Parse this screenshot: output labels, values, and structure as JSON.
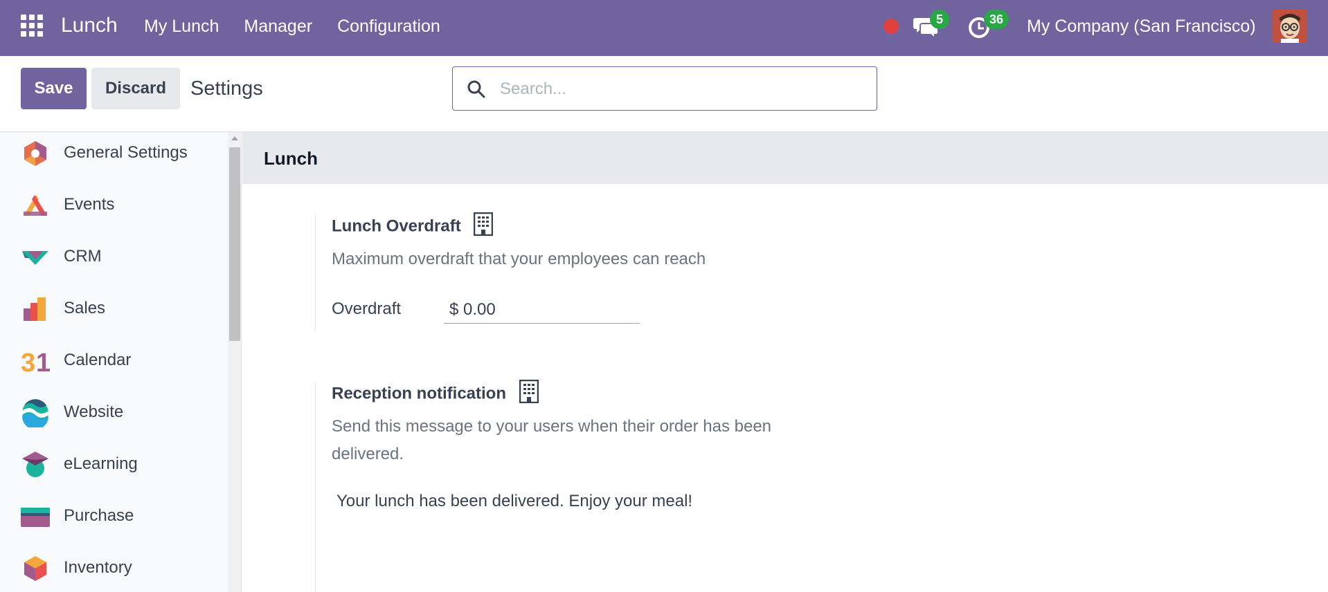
{
  "navbar": {
    "brand": "Lunch",
    "menu": [
      "My Lunch",
      "Manager",
      "Configuration"
    ],
    "messages_count": "5",
    "activities_count": "36",
    "company": "My Company (San Francisco)",
    "color": "#71639e"
  },
  "control_panel": {
    "save_label": "Save",
    "discard_label": "Discard",
    "title": "Settings",
    "search_placeholder": "Search..."
  },
  "sidebar": {
    "items": [
      {
        "label": "General Settings",
        "icon": "general-settings-icon"
      },
      {
        "label": "Events",
        "icon": "events-icon"
      },
      {
        "label": "CRM",
        "icon": "crm-icon"
      },
      {
        "label": "Sales",
        "icon": "sales-icon"
      },
      {
        "label": "Calendar",
        "icon": "calendar-icon"
      },
      {
        "label": "Website",
        "icon": "website-icon"
      },
      {
        "label": "eLearning",
        "icon": "elearning-icon"
      },
      {
        "label": "Purchase",
        "icon": "purchase-icon"
      },
      {
        "label": "Inventory",
        "icon": "inventory-icon"
      }
    ]
  },
  "main": {
    "section_title": "Lunch",
    "overdraft": {
      "title": "Lunch Overdraft",
      "description": "Maximum overdraft that your employees can reach",
      "field_label": "Overdraft",
      "field_value": "$ 0.00"
    },
    "reception": {
      "title": "Reception notification",
      "description": "Send this message to your users when their order has been delivered.",
      "message": "Your lunch has been delivered. Enjoy your meal!"
    }
  }
}
